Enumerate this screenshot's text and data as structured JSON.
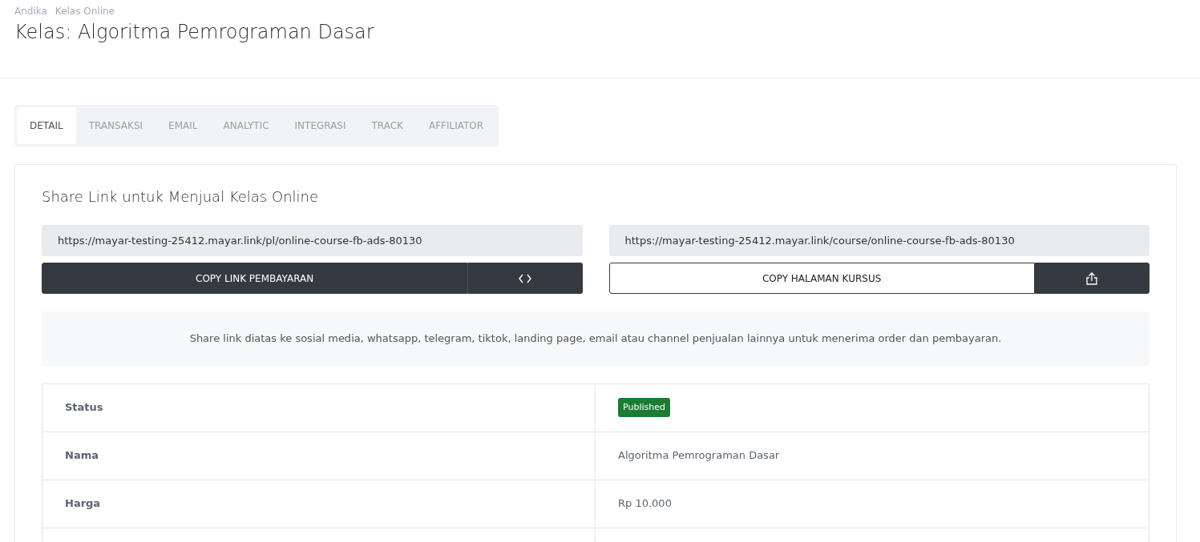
{
  "breadcrumb": [
    "Andika",
    "Kelas Online"
  ],
  "title": "Kelas: Algoritma Pemrograman Dasar",
  "tabs": [
    {
      "label": "DETAIL",
      "selected": true
    },
    {
      "label": "TRANSAKSI",
      "selected": false
    },
    {
      "label": "EMAIL",
      "selected": false
    },
    {
      "label": "ANALYTIC",
      "selected": false
    },
    {
      "label": "INTEGRASI",
      "selected": false
    },
    {
      "label": "TRACK",
      "selected": false
    },
    {
      "label": "AFFILIATOR",
      "selected": false
    }
  ],
  "share": {
    "heading": "Share Link untuk Menjual Kelas Online",
    "links": [
      {
        "url": "https://mayar-testing-25412.mayar.link/pl/online-course-fb-ads-80130",
        "button": "COPY LINK PEMBAYARAN",
        "kind": "dark"
      },
      {
        "url": "https://mayar-testing-25412.mayar.link/course/online-course-fb-ads-80130",
        "button": "COPY HALAMAN KURSUS",
        "kind": "outline"
      }
    ],
    "note": "Share link diatas ke sosial media, whatsapp, telegram, tiktok, landing page, email atau channel penjualan lainnya untuk menerima order dan pembayaran."
  },
  "details": [
    {
      "label": "Status",
      "kind": "badge",
      "value": "Published"
    },
    {
      "label": "Nama",
      "kind": "text",
      "value": "Algoritma Pemrograman Dasar"
    },
    {
      "label": "Harga",
      "kind": "text",
      "value": "Rp 10.000"
    }
  ]
}
